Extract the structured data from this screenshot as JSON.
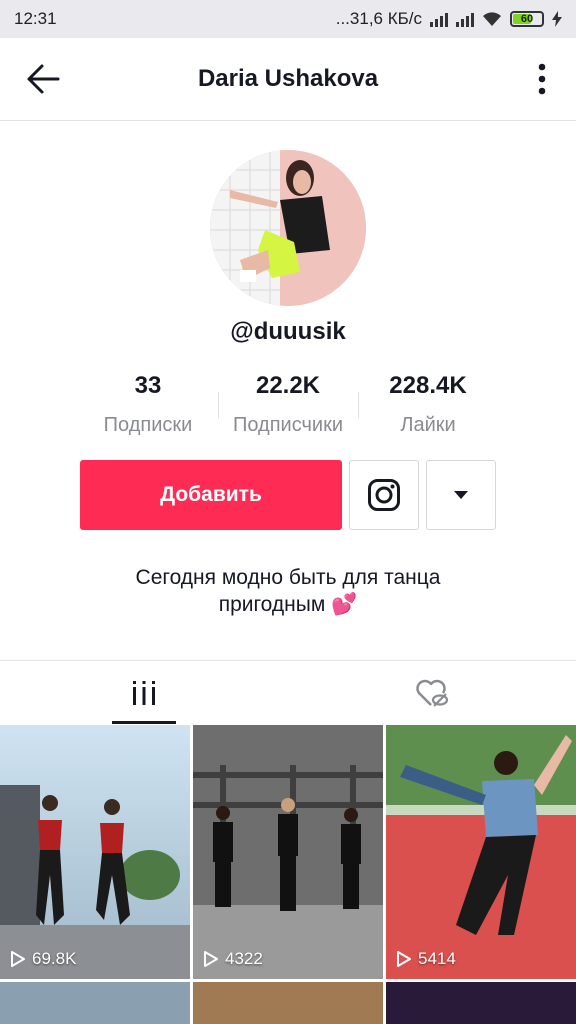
{
  "statusbar": {
    "time": "12:31",
    "network": "...31,6 КБ/с",
    "battery": "60"
  },
  "header": {
    "title": "Daria Ushakova"
  },
  "profile": {
    "handle": "@duuusik",
    "bio_line1": "Сегодня модно быть для танца",
    "bio_line2": "пригодным",
    "bio_emoji": "💕"
  },
  "stats": [
    {
      "value": "33",
      "label": "Подписки"
    },
    {
      "value": "22.2K",
      "label": "Подписчики"
    },
    {
      "value": "228.4K",
      "label": "Лайки"
    }
  ],
  "actions": {
    "add_label": "Добавить"
  },
  "videos": [
    {
      "views": "69.8K"
    },
    {
      "views": "4322"
    },
    {
      "views": "5414"
    }
  ],
  "colors": {
    "accent": "#fe2c55",
    "text": "#161823",
    "muted": "#8a8b91"
  }
}
